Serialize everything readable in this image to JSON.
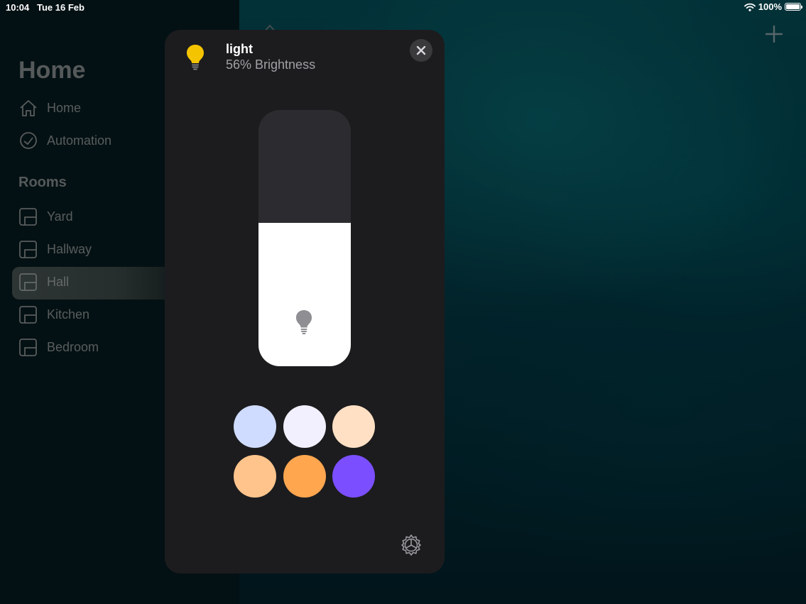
{
  "status_bar": {
    "time": "10:04",
    "date": "Tue 16 Feb",
    "battery": "100%"
  },
  "sidebar": {
    "title": "Home",
    "nav": [
      {
        "label": "Home",
        "icon": "house-icon"
      },
      {
        "label": "Automation",
        "icon": "clock-icon"
      }
    ],
    "rooms_heading": "Rooms",
    "rooms": [
      {
        "label": "Yard",
        "selected": false
      },
      {
        "label": "Hallway",
        "selected": false
      },
      {
        "label": "Hall",
        "selected": true
      },
      {
        "label": "Kitchen",
        "selected": false
      },
      {
        "label": "Bedroom",
        "selected": false
      }
    ]
  },
  "panel": {
    "title": "light",
    "subtitle": "56% Brightness",
    "brightness": 0.56,
    "icon_color": "#f5c400",
    "swatches": [
      "#d0dcff",
      "#f2f0ff",
      "#ffe0c4",
      "#ffc48c",
      "#ffa64f",
      "#7b4fff"
    ]
  },
  "toolbar": {
    "add_icon": "plus-icon"
  }
}
